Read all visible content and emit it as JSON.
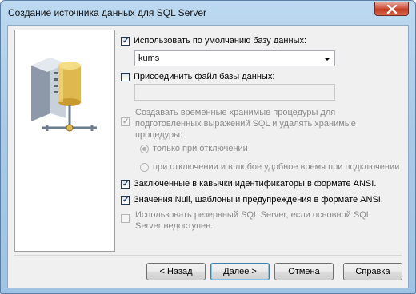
{
  "window": {
    "title": "Создание источника данных для SQL Server",
    "close_icon": "close-icon"
  },
  "illustration": {
    "icon": "server-database-icon"
  },
  "options": {
    "use_default_db": {
      "label": "Использовать по умолчанию базу данных:",
      "checked": true
    },
    "database_combo": {
      "value": "kums"
    },
    "attach_file": {
      "label": "Присоединить файл  базы данных:",
      "checked": false
    },
    "attach_file_path": {
      "value": ""
    },
    "temp_procs": {
      "line1": "Создавать временные хранимые процедуры для",
      "line2": "подготовленных выражений SQL и удалять хранимые",
      "line3": "процедуры:",
      "checked": true,
      "disabled": true
    },
    "radio_on_disconnect": {
      "label": "только при отключении",
      "selected": true
    },
    "radio_anytime": {
      "label": "при отключении и в любое удобное время при подключении",
      "selected": false
    },
    "ansi_quoted": {
      "label": "Заключенные в кавычки идентификаторы в формате ANSI.",
      "checked": true
    },
    "ansi_nulls": {
      "label": "Значения Null, шаблоны и предупреждения в формате ANSI.",
      "checked": true
    },
    "failover": {
      "line1": "Использовать резервный SQL Server, если основной SQL",
      "line2": "Server недоступен.",
      "checked": false
    }
  },
  "buttons": {
    "back": "< Назад",
    "next": "Далее >",
    "cancel": "Отмена",
    "help": "Справка"
  },
  "colors": {
    "accent": "#3c7fb1",
    "close": "#c23b22",
    "frame": "#a9cbe8"
  }
}
